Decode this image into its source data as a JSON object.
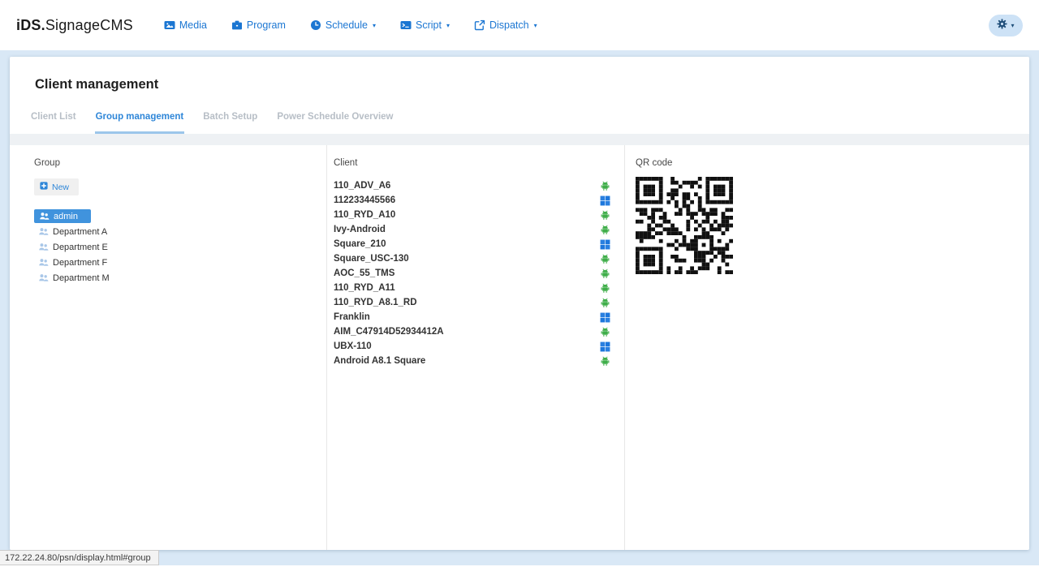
{
  "brand": {
    "bold": "iDS.",
    "rest": "SignageCMS"
  },
  "nav": {
    "items": [
      {
        "label": "Media",
        "icon": "media-icon",
        "caret": false
      },
      {
        "label": "Program",
        "icon": "program-icon",
        "caret": false
      },
      {
        "label": "Schedule",
        "icon": "schedule-icon",
        "caret": true
      },
      {
        "label": "Script",
        "icon": "script-icon",
        "caret": true
      },
      {
        "label": "Dispatch",
        "icon": "dispatch-icon",
        "caret": true
      }
    ],
    "settings_button": {
      "icon": "gear-icon",
      "caret": true
    }
  },
  "page": {
    "title": "Client management",
    "tabs": [
      {
        "label": "Client List",
        "active": false
      },
      {
        "label": "Group management",
        "active": true
      },
      {
        "label": "Batch Setup",
        "active": false
      },
      {
        "label": "Power Schedule Overview",
        "active": false
      }
    ]
  },
  "group_panel": {
    "header": "Group",
    "new_button": "New",
    "groups": [
      {
        "name": "admin",
        "selected": true,
        "child": false
      },
      {
        "name": "Department A",
        "selected": false,
        "child": true
      },
      {
        "name": "Department E",
        "selected": false,
        "child": true
      },
      {
        "name": "Department F",
        "selected": false,
        "child": true
      },
      {
        "name": "Department M",
        "selected": false,
        "child": true
      }
    ]
  },
  "client_panel": {
    "header": "Client",
    "clients": [
      {
        "name": "110_ADV_A6",
        "os": "android"
      },
      {
        "name": "112233445566",
        "os": "windows"
      },
      {
        "name": "110_RYD_A10",
        "os": "android"
      },
      {
        "name": "Ivy-Android",
        "os": "android"
      },
      {
        "name": "Square_210",
        "os": "windows"
      },
      {
        "name": "Square_USC-130",
        "os": "android"
      },
      {
        "name": "AOC_55_TMS",
        "os": "android"
      },
      {
        "name": "110_RYD_A11",
        "os": "android"
      },
      {
        "name": "110_RYD_A8.1_RD",
        "os": "android"
      },
      {
        "name": "Franklin",
        "os": "windows"
      },
      {
        "name": "AIM_C47914D52934412A",
        "os": "android"
      },
      {
        "name": "UBX-110",
        "os": "windows"
      },
      {
        "name": "Android A8.1 Square",
        "os": "android"
      }
    ]
  },
  "qr_panel": {
    "header": "QR code",
    "modules": 25,
    "seed": 7
  },
  "status_bar": {
    "url": "172.22.24.80/psn/display.html#group"
  },
  "colors": {
    "accent": "#1b76d2",
    "android_green": "#3fae49",
    "windows_blue": "#1d77dc",
    "selected_group_bg": "#4093dd",
    "group_icon_blue": "#a9c7e8",
    "page_bg": "#d9e8f6",
    "active_tab": "#2e86d8",
    "tab_underline": "#9cc6ea"
  }
}
